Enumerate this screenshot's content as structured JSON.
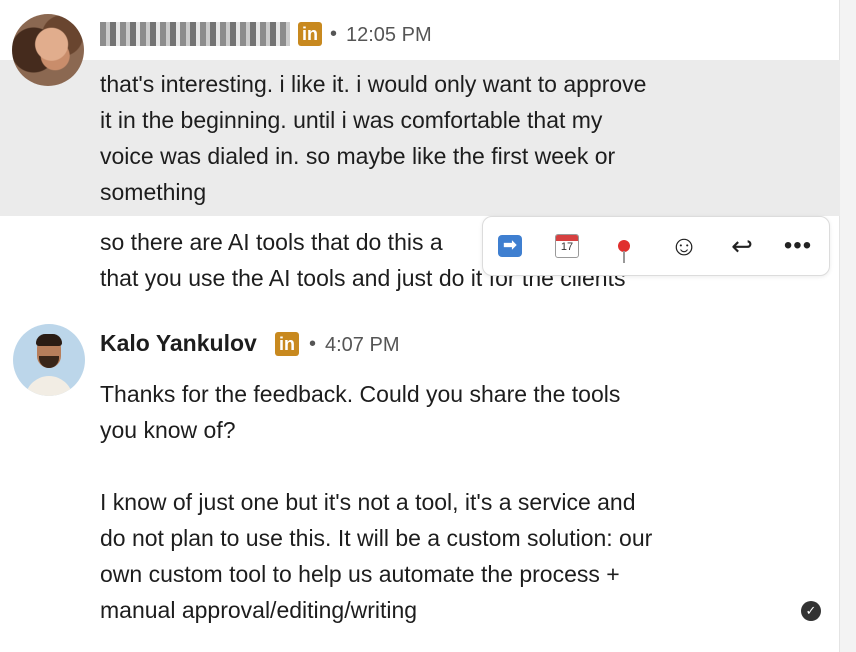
{
  "messages": [
    {
      "sender": "",
      "time": "12:05 PM",
      "text": "that's interesting. i like it. i would only want to approve\nit in the beginning. until i was comfortable that my\nvoice was dialed in. so maybe like the first week or\nsomething"
    },
    {
      "text": "so there are AI tools that do this a\nthat you use the AI tools and just do it for the clients"
    },
    {
      "sender": "Kalo Yankulov",
      "time": "4:07 PM",
      "text": "Thanks for the feedback. Could you share the tools\nyou know of?\n\nI know of just one but it's not a tool, it's a service and\ndo not plan to use this. It will be a custom solution: our\nown custom tool to help us automate the process +\nmanual approval/editing/writing"
    }
  ],
  "badge": {
    "linkedin": "in"
  },
  "separator": "•",
  "toolbar": {
    "forward_glyph": "➡",
    "calendar_day": "17",
    "emoji_glyph": "☺",
    "reply_glyph": "↩",
    "more_glyph": "•••"
  },
  "read_receipt": "✓",
  "colors": {
    "linkedin_badge": "#c8891f",
    "highlight": "#ebebeb"
  }
}
